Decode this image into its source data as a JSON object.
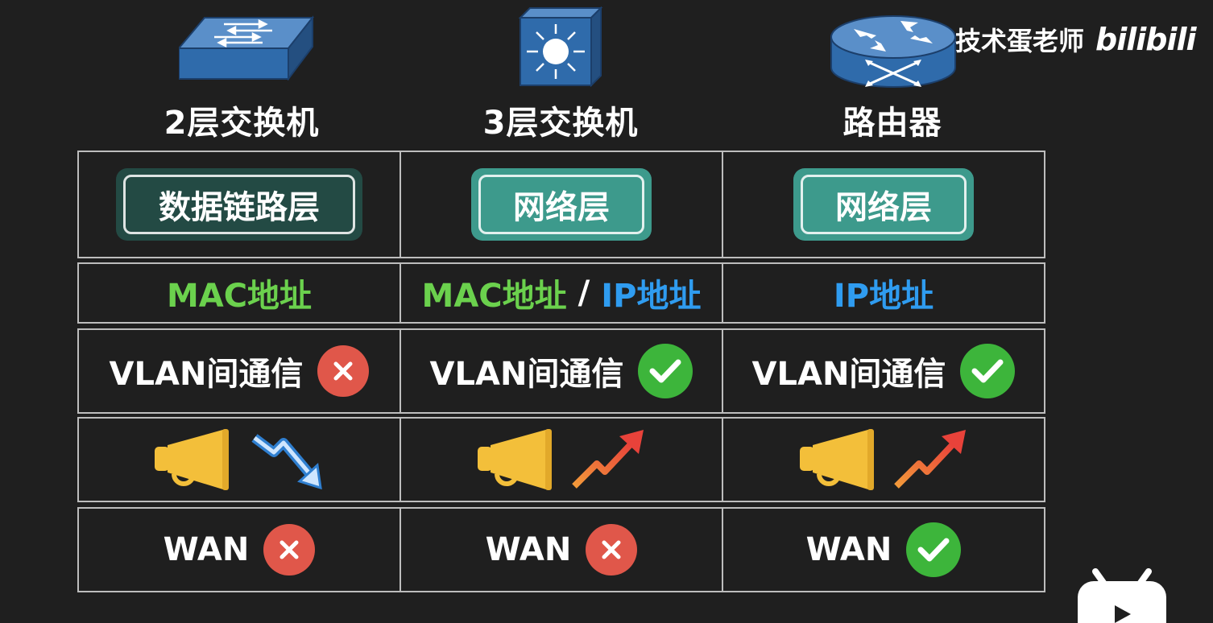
{
  "watermark": {
    "author": "技术蛋老师",
    "site": "bilibili"
  },
  "devices": [
    {
      "title": "2层交换机",
      "icon": "layer2-switch-icon"
    },
    {
      "title": "3层交换机",
      "icon": "layer3-switch-icon"
    },
    {
      "title": "路由器",
      "icon": "router-icon"
    }
  ],
  "rows": {
    "layer": [
      "数据链路层",
      "网络层",
      "网络层"
    ],
    "address": {
      "col1": {
        "mac": "MAC地址"
      },
      "col2": {
        "mac": "MAC地址",
        "sep": "/",
        "ip": "IP地址"
      },
      "col3": {
        "ip": "IP地址"
      }
    },
    "vlan": [
      {
        "label": "VLAN间通信",
        "status": "no"
      },
      {
        "label": "VLAN间通信",
        "status": "yes"
      },
      {
        "label": "VLAN间通信",
        "status": "yes"
      }
    ],
    "broadcast": [
      {
        "icon": "megaphone-icon",
        "trend": "trend-down-icon"
      },
      {
        "icon": "megaphone-icon",
        "trend": "trend-up-icon"
      },
      {
        "icon": "megaphone-icon",
        "trend": "trend-up-icon"
      }
    ],
    "wan": [
      {
        "label": "WAN",
        "status": "no"
      },
      {
        "label": "WAN",
        "status": "no"
      },
      {
        "label": "WAN",
        "status": "yes"
      }
    ]
  },
  "colors": {
    "background": "#1f1f1f",
    "mac": "#6bd14d",
    "ip": "#2f9cf0",
    "yes": "#3db53b",
    "no": "#e0574a",
    "layer_dark": "#234a44",
    "layer_light": "#3d9a8c",
    "megaphone": "#f3bf3a"
  }
}
